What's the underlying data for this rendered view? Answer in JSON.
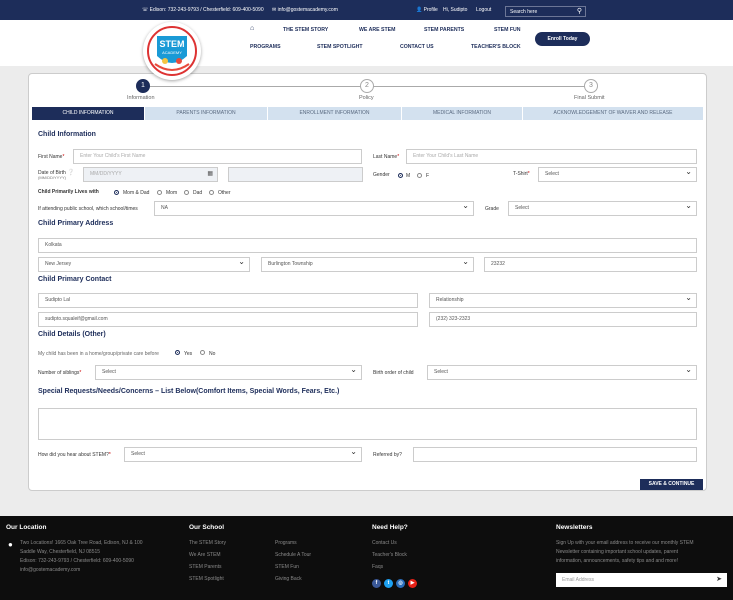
{
  "topbar": {
    "phone": "Edison: 732-243-9793 / Chesterfield: 609-400-5090",
    "email": "info@gostemacademy.com",
    "profile": "Profile",
    "greeting": "Hi, Sudipto",
    "logout": "Logout",
    "search_placeholder": "Search here"
  },
  "nav": {
    "home_icon": "home-icon",
    "row1": [
      "THE STEM STORY",
      "WE ARE STEM",
      "STEM PARENTS",
      "STEM FUN"
    ],
    "row2": [
      "PROGRAMS",
      "STEM SPOTLIGHT",
      "CONTACT US",
      "TEACHER'S BLOCK"
    ],
    "enroll": "Enroll Today"
  },
  "logo": {
    "word1": "STEM",
    "word2": "ACADEMY"
  },
  "steps": [
    {
      "num": "1",
      "label": "Information"
    },
    {
      "num": "2",
      "label": "Policy"
    },
    {
      "num": "3",
      "label": "Final Submit"
    }
  ],
  "tabs": [
    "CHILD INFORMATION",
    "PARENTS INFORMATION",
    "ENROLLMENT INFORMATION",
    "MEDICAL INFORMATION",
    "ACKNOWLEDGEMENT OF WAIVER AND RELEASE"
  ],
  "form": {
    "child_info": "Child Information",
    "first_name_label": "First Name",
    "first_name_ph": "Enter Your Child's First Name",
    "last_name_label": "Last Name",
    "last_name_ph": "Enter Your Child's Last Name",
    "dob_label": "Date of Birth",
    "dob_sub": "(MM/DD/YYYY)",
    "dob_ph": "MM/DD/YYYY",
    "gender_label": "Gender",
    "gender_m": "M",
    "gender_f": "F",
    "tshirt_label": "T-Shirt",
    "tshirt_value": "Select",
    "lives_with_label": "Child Primarily Lives with",
    "lives_opts": [
      "Mom & Dad",
      "Mom",
      "Dad",
      "Other"
    ],
    "school_label": "If attending public school, which school/times",
    "school_value": "NA",
    "grade_label": "Grade",
    "grade_value": "Select",
    "address_title": "Child Primary Address",
    "city": "Kolkata",
    "state": "New Jersey",
    "township": "Burlington Township",
    "zip": "23232",
    "contact_title": "Child Primary Contact",
    "contact_name": "Sudipto Lal",
    "relationship": "Relationship",
    "contact_email": "sudipto.squaleif@gmail.com",
    "contact_phone": "(232) 323-2323",
    "details_title": "Child Details (Other)",
    "care_question": "My child has been in a home/group/private care before",
    "care_yes": "Yes",
    "care_no": "No",
    "siblings_label": "Number of siblings",
    "siblings_value": "Select",
    "birth_order_label": "Birth order of child",
    "birth_order_value": "Select",
    "special_title": "Special Requests/Needs/Concerns – List Below(Comfort Items, Special Words, Fears, Etc.)",
    "hear_label": "How did you hear about STEM?",
    "hear_value": "Select",
    "referred_label": "Referred by?",
    "save": "SAVE & CONTINUE"
  },
  "footer": {
    "location_title": "Our Location",
    "location_lines": [
      "Two Locations! 1665 Oak Tree Road, Edison, NJ & 100",
      "Saddle Way, Chesterfield, NJ 08515",
      "Edison: 732-243-9793 / Chesterfield: 609-400-5090",
      "info@gostemacademy.com"
    ],
    "school_title": "Our School",
    "school_col1": [
      "The STEM Story",
      "We Are STEM",
      "STEM Parents",
      "STEM Spotlight"
    ],
    "school_col2": [
      "Programs",
      "Schedule A Tour",
      "STEM Fun",
      "Giving Back"
    ],
    "help_title": "Need Help?",
    "help_links": [
      "Contact Us",
      "Teacher's Block",
      "Faqs"
    ],
    "news_title": "Newsletters",
    "news_lines": [
      "Sign Up with your email address to receive our monthly STEM",
      "Newsletter containing important school updates, parent",
      "information, announcements, safety tips and and more!"
    ],
    "email_ph": "Email Address",
    "social": [
      {
        "icon": "facebook-icon",
        "glyph": "f",
        "color": "#3b5998"
      },
      {
        "icon": "twitter-icon",
        "glyph": "t",
        "color": "#1da1f2"
      },
      {
        "icon": "instagram-icon",
        "glyph": "◎",
        "color": "#2a6ebb"
      },
      {
        "icon": "youtube-icon",
        "glyph": "▶",
        "color": "#e62117"
      }
    ]
  }
}
